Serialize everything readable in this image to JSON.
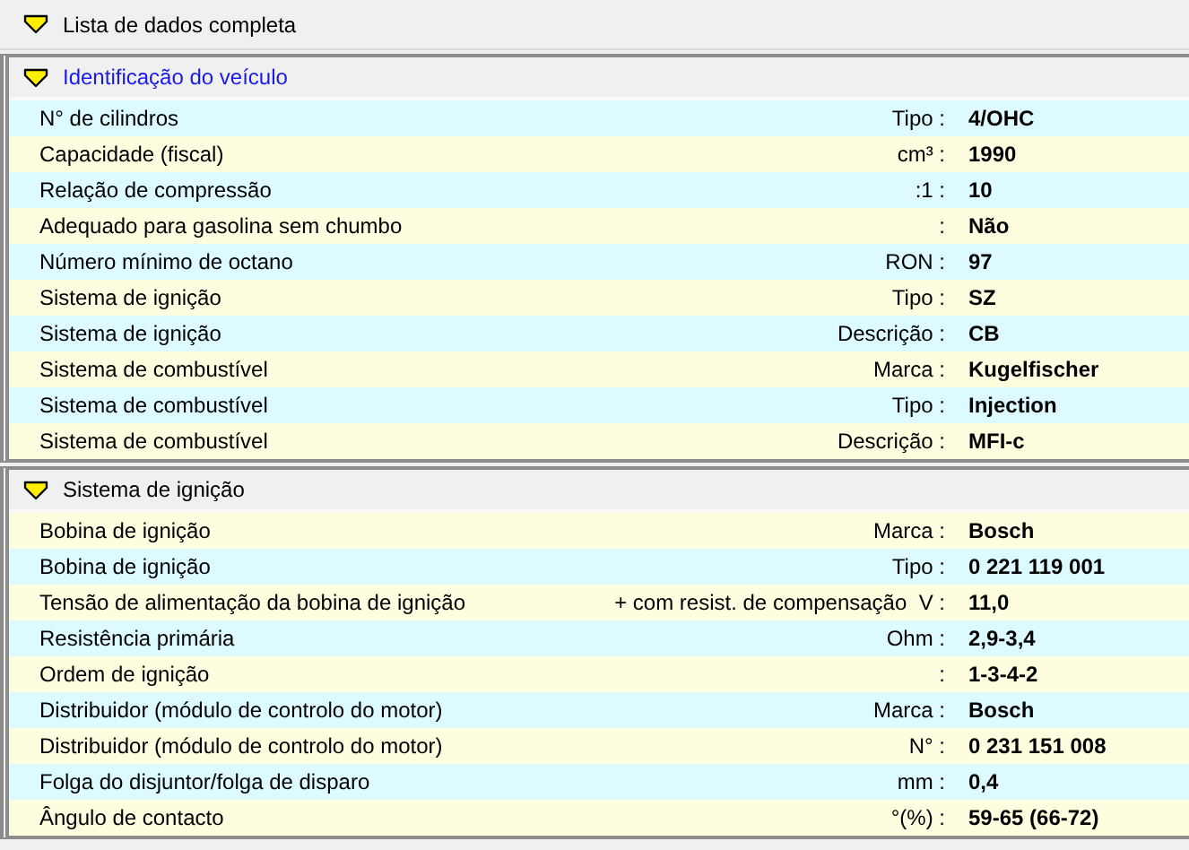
{
  "header": {
    "title": "Lista de dados completa"
  },
  "sections": [
    {
      "title": "Identificação do veículo",
      "active": true,
      "rows": [
        {
          "label": "N° de cilindros",
          "unit": "Tipo :",
          "value": "4/OHC"
        },
        {
          "label": "Capacidade (fiscal)",
          "unit": "cm³ :",
          "value": "1990"
        },
        {
          "label": "Relação de compressão",
          "unit": ":1 :",
          "value": "10"
        },
        {
          "label": "Adequado para gasolina sem chumbo",
          "unit": ":",
          "value": "Não"
        },
        {
          "label": "Número mínimo de octano",
          "unit": "RON :",
          "value": "97"
        },
        {
          "label": "Sistema de ignição",
          "unit": "Tipo :",
          "value": "SZ"
        },
        {
          "label": "Sistema de ignição",
          "unit": "Descrição :",
          "value": "CB"
        },
        {
          "label": "Sistema de combustível",
          "unit": "Marca :",
          "value": "Kugelfischer"
        },
        {
          "label": "Sistema de combustível",
          "unit": "Tipo :",
          "value": "Injection"
        },
        {
          "label": "Sistema de combustível",
          "unit": "Descrição :",
          "value": "MFI-c"
        }
      ]
    },
    {
      "title": "Sistema de ignição",
      "active": false,
      "rows": [
        {
          "label": "Bobina de ignição",
          "unit": "Marca :",
          "value": "Bosch"
        },
        {
          "label": "Bobina de ignição",
          "unit": "Tipo :",
          "value": "0 221 119 001"
        },
        {
          "label": "Tensão de alimentação da bobina de ignição",
          "unit": "+ com resist. de compensação  V :",
          "value": "11,0"
        },
        {
          "label": "Resistência primária",
          "unit": "Ohm :",
          "value": "2,9-3,4"
        },
        {
          "label": "Ordem de ignição",
          "unit": ":",
          "value": "1-3-4-2"
        },
        {
          "label": "Distribuidor (módulo de controlo do motor)",
          "unit": "Marca :",
          "value": "Bosch"
        },
        {
          "label": "Distribuidor (módulo de controlo do motor)",
          "unit": "N° :",
          "value": "0 231 151 008"
        },
        {
          "label": "Folga do disjuntor/folga de disparo",
          "unit": "mm :",
          "value": "0,4"
        },
        {
          "label": "Ângulo de contacto",
          "unit": "°(%) :",
          "value": "59-65 (66-72)"
        }
      ]
    }
  ]
}
